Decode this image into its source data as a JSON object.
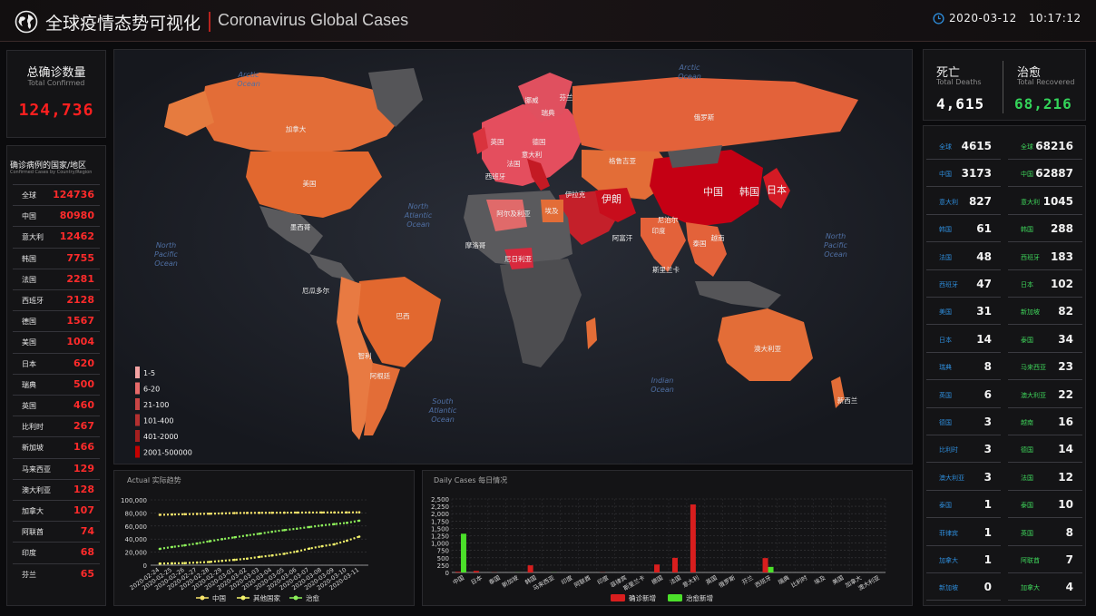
{
  "header": {
    "title_cn": "全球疫情态势可视化",
    "title_en": "Coronavirus Global Cases",
    "date": "2020-03-12",
    "time": "10:17:12",
    "icons": [
      "globe-icon",
      "clock-icon"
    ]
  },
  "confirmed": {
    "label_cn": "总确诊数量",
    "label_en": "Total Confirmed",
    "value": "124,736",
    "list_title_cn": "确诊病例的国家/地区",
    "list_title_en": "Confirmed Cases by Country/Region",
    "rows": [
      {
        "name": "全球",
        "value": "124736"
      },
      {
        "name": "中国",
        "value": "80980"
      },
      {
        "name": "意大利",
        "value": "12462"
      },
      {
        "name": "韩国",
        "value": "7755"
      },
      {
        "name": "法国",
        "value": "2281"
      },
      {
        "name": "西班牙",
        "value": "2128"
      },
      {
        "name": "德国",
        "value": "1567"
      },
      {
        "name": "美国",
        "value": "1004"
      },
      {
        "name": "日本",
        "value": "620"
      },
      {
        "name": "瑞典",
        "value": "500"
      },
      {
        "name": "英国",
        "value": "460"
      },
      {
        "name": "比利时",
        "value": "267"
      },
      {
        "name": "新加坡",
        "value": "166"
      },
      {
        "name": "马来西亚",
        "value": "129"
      },
      {
        "name": "澳大利亚",
        "value": "128"
      },
      {
        "name": "加拿大",
        "value": "107"
      },
      {
        "name": "阿联酋",
        "value": "74"
      },
      {
        "name": "印度",
        "value": "68"
      },
      {
        "name": "芬兰",
        "value": "65"
      }
    ]
  },
  "deaths": {
    "label_cn": "死亡",
    "label_en": "Total Deaths",
    "value": "4,615",
    "rows": [
      {
        "name": "全球",
        "value": "4615"
      },
      {
        "name": "中国",
        "value": "3173"
      },
      {
        "name": "意大利",
        "value": "827"
      },
      {
        "name": "韩国",
        "value": "61"
      },
      {
        "name": "法国",
        "value": "48"
      },
      {
        "name": "西班牙",
        "value": "47"
      },
      {
        "name": "美国",
        "value": "31"
      },
      {
        "name": "日本",
        "value": "14"
      },
      {
        "name": "瑞典",
        "value": "8"
      },
      {
        "name": "英国",
        "value": "6"
      },
      {
        "name": "德国",
        "value": "3"
      },
      {
        "name": "比利时",
        "value": "3"
      },
      {
        "name": "澳大利亚",
        "value": "3"
      },
      {
        "name": "泰国",
        "value": "1"
      },
      {
        "name": "菲律宾",
        "value": "1"
      },
      {
        "name": "加拿大",
        "value": "1"
      },
      {
        "name": "新加坡",
        "value": "0"
      }
    ]
  },
  "recovered": {
    "label_cn": "治愈",
    "label_en": "Total Recovered",
    "value": "68,216",
    "rows": [
      {
        "name": "全球",
        "value": "68216"
      },
      {
        "name": "中国",
        "value": "62887"
      },
      {
        "name": "意大利",
        "value": "1045"
      },
      {
        "name": "韩国",
        "value": "288"
      },
      {
        "name": "西班牙",
        "value": "183"
      },
      {
        "name": "日本",
        "value": "102"
      },
      {
        "name": "新加坡",
        "value": "82"
      },
      {
        "name": "泰国",
        "value": "34"
      },
      {
        "name": "马来西亚",
        "value": "23"
      },
      {
        "name": "澳大利亚",
        "value": "22"
      },
      {
        "name": "越南",
        "value": "16"
      },
      {
        "name": "德国",
        "value": "14"
      },
      {
        "name": "法国",
        "value": "12"
      },
      {
        "name": "泰国",
        "value": "10"
      },
      {
        "name": "英国",
        "value": "8"
      },
      {
        "name": "阿联酋",
        "value": "7"
      },
      {
        "name": "加拿大",
        "value": "4"
      }
    ]
  },
  "map": {
    "ocean_labels": [
      "Arctic Ocean",
      "Arctic Ocean",
      "North Pacific Ocean",
      "North Atlantic Ocean",
      "North Pacific Ocean",
      "South Atlantic Ocean",
      "Indian Ocean"
    ],
    "country_labels": [
      "加拿大",
      "美国",
      "墨西哥",
      "厄瓜多尔",
      "巴西",
      "智利",
      "阿根廷",
      "英国",
      "法国",
      "西班牙",
      "意大利",
      "德国",
      "俄罗斯",
      "格鲁吉亚",
      "伊拉克",
      "伊朗",
      "阿尔及利亚",
      "埃及",
      "尼日利亚",
      "摩洛哥",
      "中国",
      "韩国",
      "日本",
      "印度",
      "泰国",
      "越南",
      "斯里兰卡",
      "澳大利亚",
      "新西兰",
      "尼泊尔",
      "阿富汗",
      "芬兰",
      "瑞典",
      "挪威"
    ],
    "legend": [
      {
        "label": "1-5",
        "color": "#f4a3a3"
      },
      {
        "label": "6-20",
        "color": "#e86a6a"
      },
      {
        "label": "21-100",
        "color": "#c94545"
      },
      {
        "label": "101-400",
        "color": "#b33030"
      },
      {
        "label": "401-2000",
        "color": "#a51f1f"
      },
      {
        "label": "2001-500000",
        "color": "#c40000"
      }
    ]
  },
  "chart_data": [
    {
      "type": "line",
      "title": "Actual 实际趋势",
      "x": [
        "2020-02-24",
        "2020-02-25",
        "2020-02-26",
        "2020-02-27",
        "2020-02-28",
        "2020-02-29",
        "2020-03-01",
        "2020-03-02",
        "2020-03-03",
        "2020-03-04",
        "2020-03-05",
        "2020-03-06",
        "2020-03-07",
        "2020-03-08",
        "2020-03-09",
        "2020-03-10",
        "2020-03-11"
      ],
      "x_tick_labels": [
        "2020-02-24",
        "2020-02-25",
        "2020-02-26",
        "2020-02-27",
        "2020-02-28",
        "2020-02-29",
        "2020-03-01",
        "2020-03-02",
        "2020-03-03",
        "2020-03-04",
        "2020-03-05",
        "2020-03-06",
        "2020-03-07",
        "2020-03-08",
        "2020-03-09",
        "2020-03-10",
        "2020-03-11"
      ],
      "ylim": [
        0,
        100000
      ],
      "y_ticks": [
        "0",
        "20,000",
        "40,000",
        "60,000",
        "80,000",
        "100,000"
      ],
      "series": [
        {
          "name": "中国",
          "color": "#f6e36a",
          "values": [
            77150,
            77660,
            78065,
            78498,
            78824,
            79251,
            79826,
            80026,
            80151,
            80270,
            80409,
            80552,
            80651,
            80695,
            80735,
            80754,
            80980
          ]
        },
        {
          "name": "其他国家",
          "color": "#f2f26b",
          "values": [
            2460,
            2800,
            3200,
            4100,
            5000,
            6700,
            8200,
            10000,
            12700,
            14900,
            17500,
            21000,
            25500,
            29000,
            32000,
            37500,
            43756
          ]
        },
        {
          "name": "治愈",
          "color": "#8df05a",
          "values": [
            25000,
            27900,
            30400,
            33300,
            36700,
            39800,
            42700,
            45600,
            48200,
            51200,
            53800,
            55900,
            58400,
            60900,
            62900,
            64800,
            68216
          ]
        }
      ],
      "grid": true,
      "legend": "bottom"
    },
    {
      "type": "bar",
      "title": "Daily Cases 每日情况",
      "categories": [
        "中国",
        "日本",
        "泰国",
        "新加坡",
        "韩国",
        "马来西亚",
        "越南",
        "阿联酋",
        "印度",
        "菲律宾",
        "斯里兰卡",
        "德国",
        "法国",
        "意大利",
        "英国",
        "俄罗斯",
        "芬兰",
        "西班牙",
        "瑞典",
        "比利时",
        "埃及",
        "美国",
        "加拿大",
        "澳大利亚"
      ],
      "tick_labels": [
        "中国",
        "日本",
        "泰国",
        "新加坡",
        "韩国",
        "马来西亚",
        "印度",
        "阿联酋",
        "印度",
        "菲律宾",
        "斯里兰卡",
        "德国",
        "法国",
        "意大利",
        "英国",
        "俄罗斯",
        "芬兰",
        "西班牙",
        "瑞典",
        "比利时",
        "埃及",
        "美国",
        "加拿大",
        "澳大利亚"
      ],
      "ylim": [
        0,
        2500
      ],
      "y_ticks": [
        "0",
        "250",
        "500",
        "750",
        "1,000",
        "1,250",
        "1,500",
        "1,750",
        "2,000",
        "2,250",
        "2,500"
      ],
      "series": [
        {
          "name": "确诊新增",
          "color": "#d81e1e",
          "values": [
            24,
            52,
            6,
            0,
            242,
            0,
            0,
            0,
            6,
            0,
            0,
            271,
            497,
            2313,
            0,
            0,
            0,
            489,
            0,
            0,
            0,
            0,
            0,
            0
          ]
        },
        {
          "name": "治愈新增",
          "color": "#4be02a",
          "values": [
            1318,
            0,
            0,
            4,
            0,
            4,
            0,
            0,
            0,
            0,
            0,
            0,
            0,
            0,
            0,
            0,
            0,
            190,
            0,
            0,
            0,
            0,
            0,
            0
          ]
        }
      ],
      "grid": true,
      "legend": "bottom"
    }
  ]
}
